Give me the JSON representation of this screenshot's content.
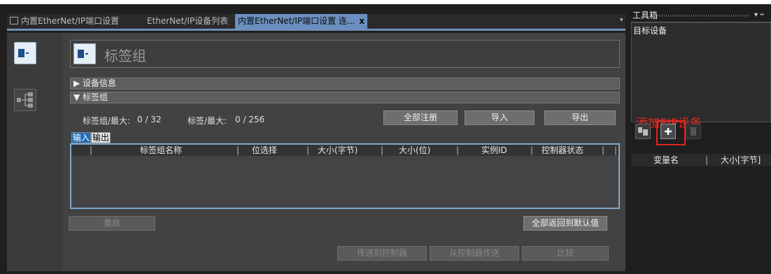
{
  "tabs": [
    {
      "label": "内置EtherNet/IP端口设置",
      "active": false
    },
    {
      "label": "EtherNet/IP设备列表",
      "active": false
    },
    {
      "label": "内置EtherNet/IP端口设置 连...",
      "active": true
    }
  ],
  "tab_close": "x",
  "tab_overflow": "▾",
  "panel": {
    "title": "标签组",
    "section_device_info": "▶ 设备信息",
    "section_tag_group": "▼ 标签组",
    "tag_group_max_label": "标签组/最大:",
    "tag_group_max_value": "0 / 32",
    "tag_max_label": "标签/最大:",
    "tag_max_value": "0 / 256",
    "btn_register_all": "全部注册",
    "btn_import": "导入",
    "btn_export": "导出",
    "subtab_input": "输入",
    "subtab_output": "输出",
    "columns": [
      "标签组名称",
      "位选择",
      "大小(字节)",
      "大小(位)",
      "实例ID",
      "控制器状态"
    ],
    "btn_restart": "重启",
    "btn_reset_defaults": "全部返回到默认值",
    "btn_send_to_controller": "传送到控制器",
    "btn_from_controller": "从控制器传送",
    "btn_compare": "比较"
  },
  "toolbox": {
    "title": "工具箱",
    "pin": "▾ ┅",
    "target_device_label": "目标设备",
    "annotation": "添加EIP设备",
    "var_columns": [
      "变量名",
      "大小[字节]"
    ]
  },
  "colors": {
    "accent": "#6a8fbf",
    "annotation_red": "#e0281e",
    "subtab_active": "#1e6fb8"
  }
}
